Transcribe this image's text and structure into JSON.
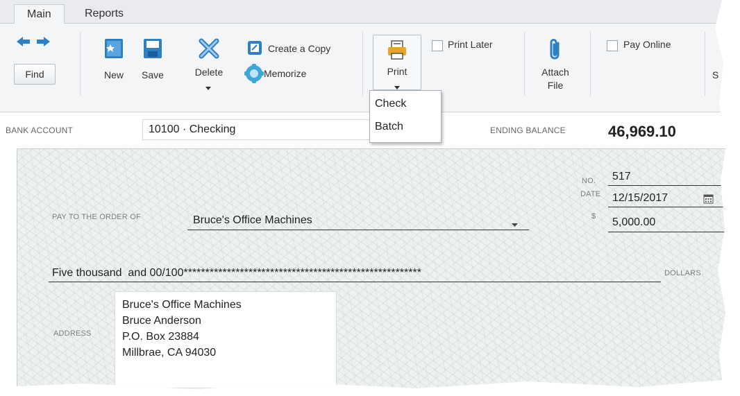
{
  "tabs": [
    {
      "label": "Main",
      "selected": true
    },
    {
      "label": "Reports",
      "selected": false
    }
  ],
  "toolbar": {
    "find_label": "Find",
    "new_label": "New",
    "save_label": "Save",
    "delete_label": "Delete",
    "create_copy_label": "Create a Copy",
    "memorize_label": "Memorize",
    "print_label": "Print",
    "print_later_label": "Print Later",
    "print_later_checked": false,
    "attach_file_label_line1": "Attach",
    "attach_file_label_line2": "File",
    "pay_online_label": "Pay Online",
    "pay_online_checked": false,
    "cut_off_label": "S"
  },
  "print_menu": {
    "items": [
      "Check",
      "Batch"
    ]
  },
  "header": {
    "bank_account_label": "BANK ACCOUNT",
    "bank_account_value": "10100 · Checking",
    "ending_balance_label": "ENDING BALANCE",
    "ending_balance_value": "46,969.10"
  },
  "check": {
    "no_label": "NO.",
    "no_value": "517",
    "date_label": "DATE",
    "date_value": "12/15/2017",
    "pay_to_label": "PAY TO THE ORDER OF",
    "payee_value": "Bruce's Office Machines",
    "dollar_sign_label": "$",
    "amount_value": "5,000.00",
    "amount_words": "Five thousand  and 00/100*******************************************************",
    "dollars_label": "DOLLARS",
    "address_label": "ADDRESS",
    "address_lines": [
      "Bruce's Office Machines",
      "Bruce Anderson",
      "P.O. Box 23884",
      "Millbrae, CA 94030"
    ]
  },
  "colors": {
    "tab_bg": "#e9ebee",
    "toolbar_bg": "#f4f5f7",
    "icon_blue": "#2f7fc6",
    "check_bg": "#eef2ef"
  }
}
